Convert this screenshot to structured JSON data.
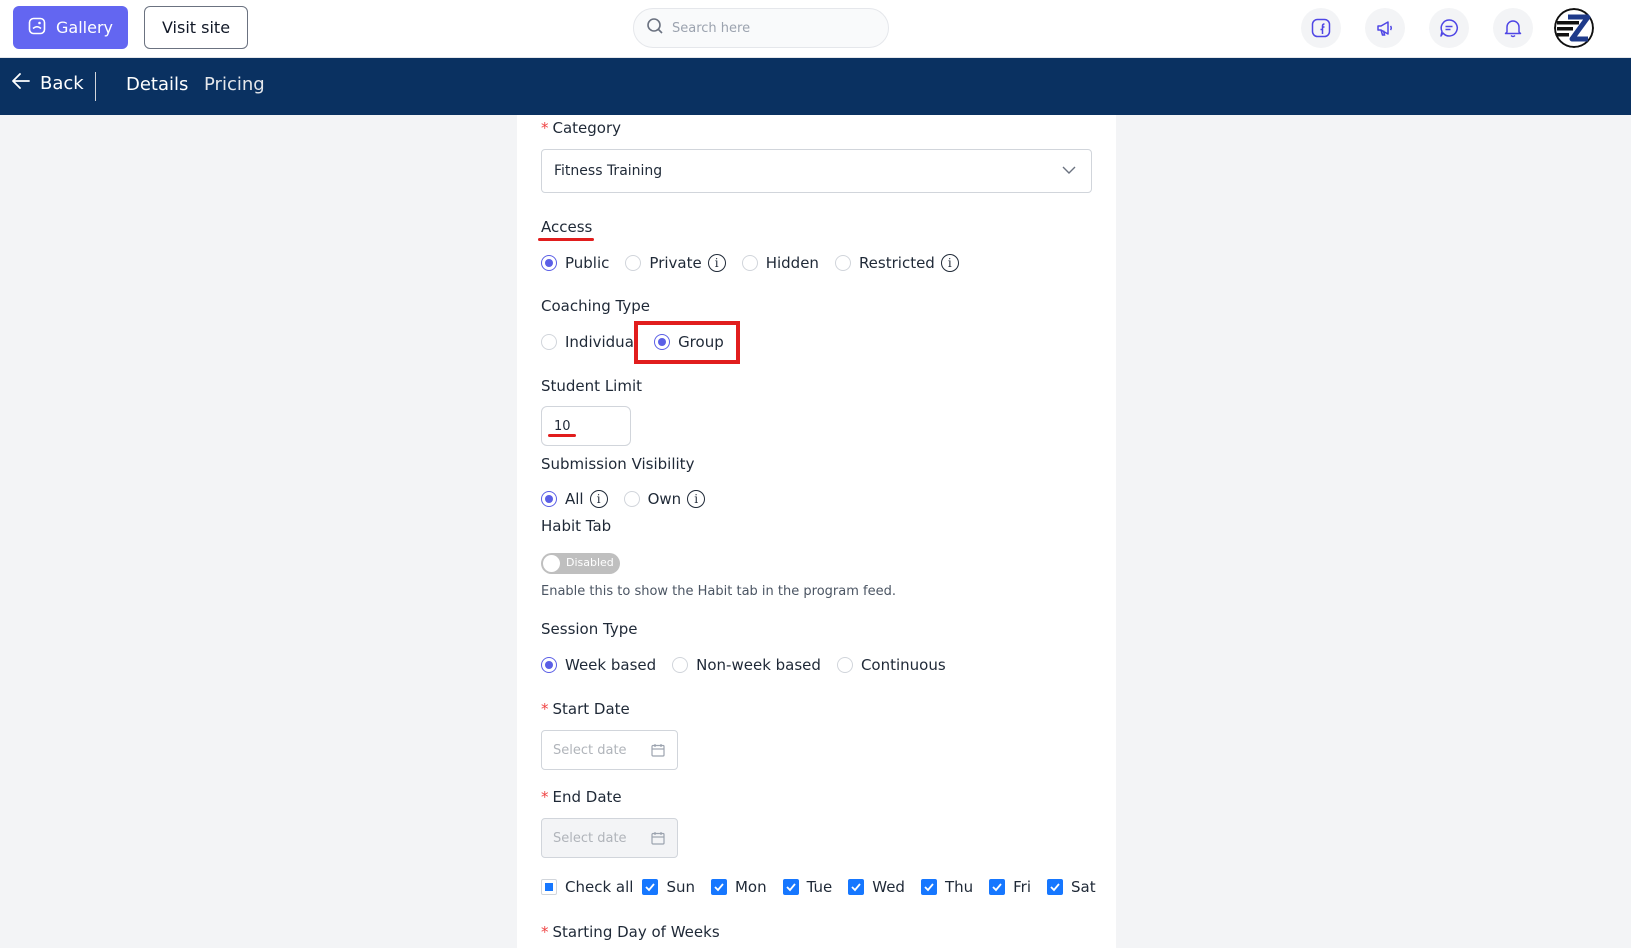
{
  "header": {
    "gallery_label": "Gallery",
    "visit_label": "Visit site",
    "search_placeholder": "Search here",
    "icons": [
      "facebook-icon",
      "megaphone-icon",
      "chat-icon",
      "bell-icon"
    ]
  },
  "nav": {
    "back_label": "Back",
    "tabs": [
      "Details",
      "Pricing"
    ]
  },
  "form": {
    "category": {
      "label": "Category",
      "value": "Fitness Training"
    },
    "access": {
      "label": "Access",
      "options": [
        "Public",
        "Private",
        "Hidden",
        "Restricted"
      ],
      "selected": "Public"
    },
    "coaching_type": {
      "label": "Coaching Type",
      "options": [
        "Individual",
        "Group"
      ],
      "selected": "Group"
    },
    "student_limit": {
      "label": "Student Limit",
      "value": "10"
    },
    "submission_visibility": {
      "label": "Submission Visibility",
      "options": [
        "All",
        "Own"
      ],
      "selected": "All"
    },
    "habit_tab": {
      "label": "Habit Tab",
      "toggle_text": "Disabled",
      "help": "Enable this to show the Habit tab in the program feed."
    },
    "session_type": {
      "label": "Session Type",
      "options": [
        "Week based",
        "Non-week based",
        "Continuous"
      ],
      "selected": "Week based"
    },
    "start_date": {
      "label": "Start Date",
      "placeholder": "Select date"
    },
    "end_date": {
      "label": "End Date",
      "placeholder": "Select date"
    },
    "days": {
      "check_all": "Check all",
      "items": [
        "Sun",
        "Mon",
        "Tue",
        "Wed",
        "Thu",
        "Fri",
        "Sat"
      ]
    },
    "starting_day": {
      "label": "Starting Day of Weeks"
    }
  },
  "colors": {
    "accent": "#6366f1",
    "nav_bg": "#0a3161",
    "annotation": "#e11d1d",
    "checkbox": "#1677ff"
  }
}
